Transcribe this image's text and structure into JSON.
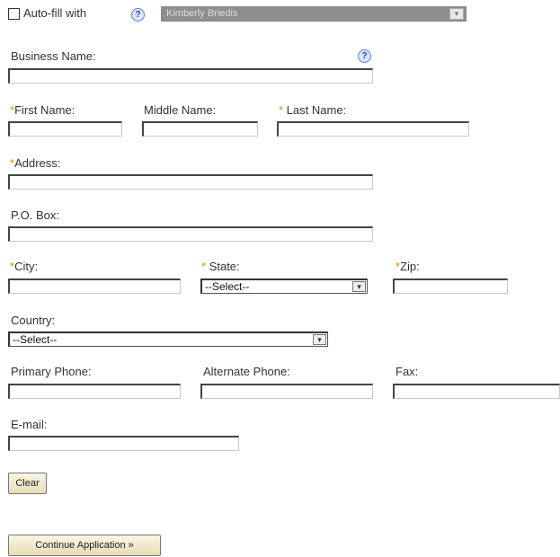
{
  "autofill": {
    "label": "Auto-fill with",
    "help": "?",
    "selected": "Kimberly Briedis",
    "arrow": "▾"
  },
  "business_name": {
    "label": "Business Name:",
    "help": "?"
  },
  "first_name": {
    "required_mark": "*",
    "label": "First Name:"
  },
  "middle_name": {
    "label": "Middle Name:"
  },
  "last_name": {
    "required_mark": "*",
    "label": "Last Name:"
  },
  "address": {
    "required_mark": "*",
    "label": "Address:"
  },
  "po_box": {
    "label": "P.O. Box:"
  },
  "city": {
    "required_mark": "*",
    "label": "City:"
  },
  "state": {
    "required_mark": "*",
    "label": "State:",
    "selected": "--Select--",
    "arrow": "▾"
  },
  "zip": {
    "required_mark": "*",
    "label": "Zip:"
  },
  "country": {
    "label": "Country:",
    "selected": "--Select--",
    "arrow": "▾"
  },
  "primary_phone": {
    "label": "Primary Phone:"
  },
  "alternate_phone": {
    "label": "Alternate Phone:"
  },
  "fax": {
    "label": "Fax:"
  },
  "email": {
    "label": "E-mail:"
  },
  "buttons": {
    "clear": "Clear",
    "continue": "Continue Application »"
  },
  "colors": {
    "required": "#e08a00",
    "help_bg": "#dbe6fb",
    "button_bg": "#f0e8c8"
  }
}
